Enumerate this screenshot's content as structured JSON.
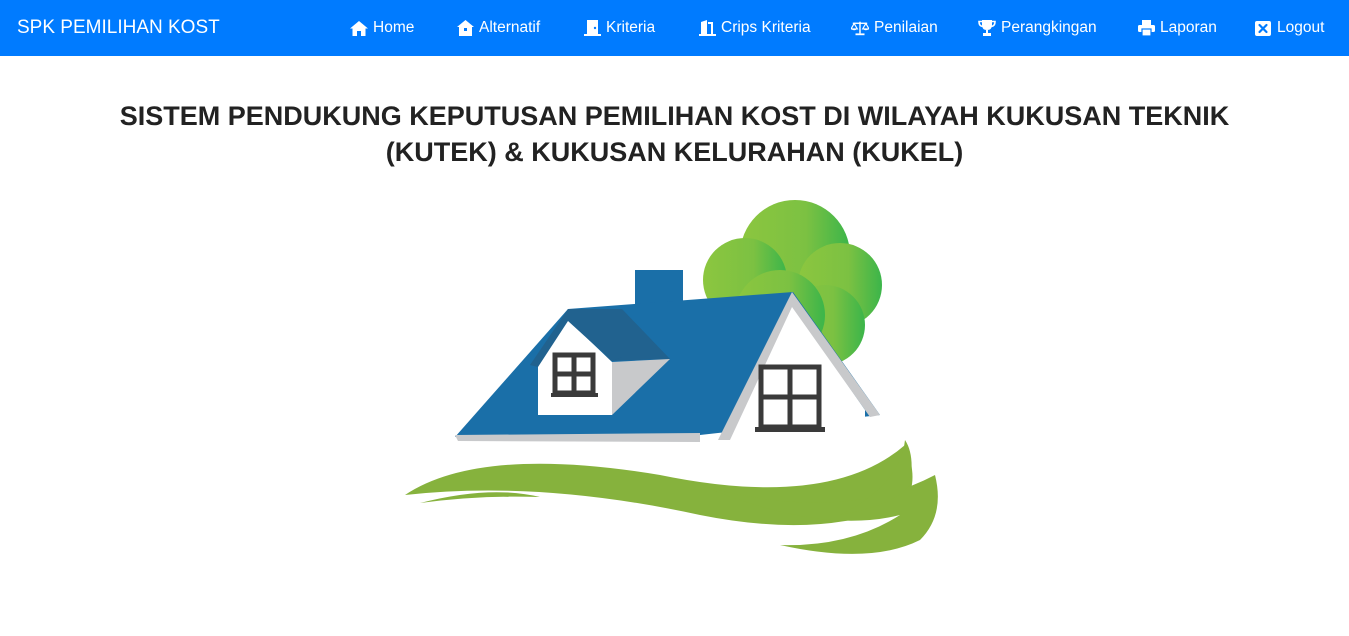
{
  "navbar": {
    "brand": "SPK PEMILIHAN KOST",
    "accent_color": "#007bff",
    "items": [
      {
        "label": "Home",
        "icon": "home-icon"
      },
      {
        "label": "Alternatif",
        "icon": "house-alt-icon"
      },
      {
        "label": "Kriteria",
        "icon": "door-icon"
      },
      {
        "label": "Crips Kriteria",
        "icon": "door-open-icon"
      },
      {
        "label": "Penilaian",
        "icon": "balance-scale-icon"
      },
      {
        "label": "Perangkingan",
        "icon": "trophy-icon"
      },
      {
        "label": "Laporan",
        "icon": "print-icon"
      },
      {
        "label": "Logout",
        "icon": "close-box-icon"
      }
    ]
  },
  "main": {
    "title_line1": "SISTEM PENDUKUNG KEPUTUSAN PEMILIHAN KOST DI WILAYAH KUKUSAN TEKNIK",
    "title_line2": "(KUTEK) & KUKUSAN KELURAHAN (KUKEL)",
    "logo": {
      "icon": "house-tree-logo",
      "colors": {
        "roof": "#1a6fa8",
        "roof_dark": "#21628f",
        "tree_light": "#8cc63f",
        "tree_dark": "#3bb54a",
        "grass": "#86b23d",
        "window": "#3a3a3a",
        "wall_shade": "#c8c9cb"
      }
    }
  }
}
